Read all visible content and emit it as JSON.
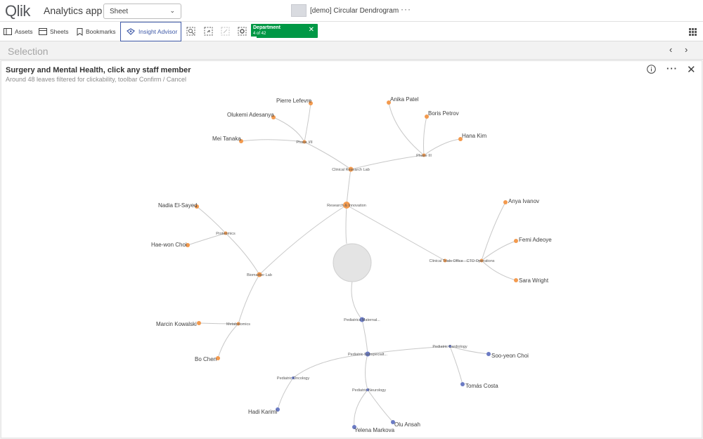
{
  "header": {
    "logo": "Qlik",
    "app_title": "Analytics app",
    "sheet_select": "Sheet",
    "sheet_name": "[demo] Circular Dendrogram",
    "more": "···"
  },
  "toolbar": {
    "assets": "Assets",
    "sheets": "Sheets",
    "bookmarks": "Bookmarks",
    "insight_advisor": "Insight Advisor",
    "chip_field": "Department",
    "chip_count": "4 of 42"
  },
  "selection": {
    "title": "Selection"
  },
  "panel": {
    "title": "Surgery and Mental Health, click any staff member",
    "subtitle": "Around 48 leaves filtered for clickability, toolbar Confirm / Cancel"
  },
  "colors": {
    "orange": "#f39a4e",
    "blue": "#6b7bc4",
    "green": "#009845",
    "link": "#c8c8c8"
  },
  "dendrogram": {
    "branches": [
      "Research & Innovation",
      "Clinical Research Lab",
      "Phase I/II",
      "Phase III",
      "Biomarker Lab",
      "Proteomics",
      "Metabolomics",
      "Clinical Trials Office · CTO Operations",
      "Pediatrics Maternal...",
      "Pediatric Subspecialt...",
      "Pediatric Oncology",
      "Pediatric Neurology",
      "Pediatric Cardiology"
    ],
    "leaves": [
      "Pierre Lefevre",
      "Olukemi Adesanya",
      "Mei Tanaka",
      "Anika Patel",
      "Boris Petrov",
      "Hana Kim",
      "Nadia El-Sayed",
      "Hae-won Choi",
      "Marcin Kowalski",
      "Bo Chen",
      "Anya Ivanov",
      "Femi Adeoye",
      "Sara Wright",
      "Soo-yeon Choi",
      "Tomás Costa",
      "Hadi Karimi",
      "Olu Ansah",
      "Yelena Markova"
    ]
  }
}
